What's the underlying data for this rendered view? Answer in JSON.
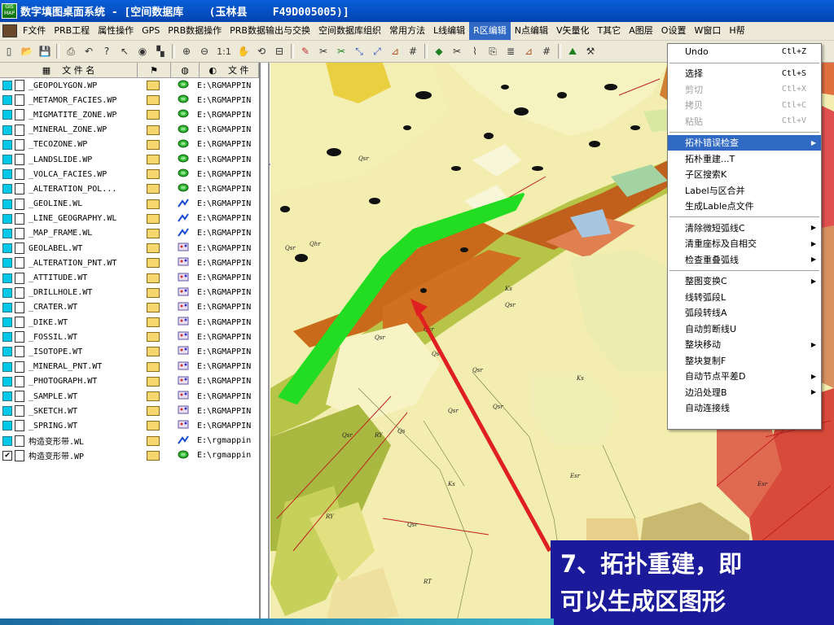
{
  "window": {
    "title": "数字填图桌面系统 - [空间数据库    (玉林县    F49D005005)]"
  },
  "menubar": {
    "items": [
      "F文件",
      "PRB工程",
      "属性操作",
      "GPS",
      "PRB数据操作",
      "PRB数据输出与交换",
      "空间数据库组织",
      "常用方法",
      "L线编辑",
      "R区编辑",
      "N点编辑",
      "V矢量化",
      "T其它",
      "A图层",
      "O设置",
      "W窗口",
      "H帮"
    ]
  },
  "file_panel": {
    "headers": [
      "文 件 名",
      "文 件"
    ],
    "rows": [
      {
        "checked": false,
        "name": "_GEOPOLYGON.WP",
        "type": "polygon",
        "path": "E:\\RGMAPPIN"
      },
      {
        "checked": false,
        "name": "_METAMOR_FACIES.WP",
        "type": "polygon",
        "path": "E:\\RGMAPPIN"
      },
      {
        "checked": false,
        "name": "_MIGMATITE_ZONE.WP",
        "type": "polygon",
        "path": "E:\\RGMAPPIN"
      },
      {
        "checked": false,
        "name": "_MINERAL_ZONE.WP",
        "type": "polygon",
        "path": "E:\\RGMAPPIN"
      },
      {
        "checked": false,
        "name": "_TECOZONE.WP",
        "type": "polygon",
        "path": "E:\\RGMAPPIN"
      },
      {
        "checked": false,
        "name": "_LANDSLIDE.WP",
        "type": "polygon",
        "path": "E:\\RGMAPPIN"
      },
      {
        "checked": false,
        "name": "_VOLCA_FACIES.WP",
        "type": "polygon",
        "path": "E:\\RGMAPPIN"
      },
      {
        "checked": false,
        "name": "_ALTERATION_POL...",
        "type": "polygon",
        "path": "E:\\RGMAPPIN"
      },
      {
        "checked": false,
        "name": "_GEOLINE.WL",
        "type": "line",
        "path": "E:\\RGMAPPIN"
      },
      {
        "checked": false,
        "name": "_LINE_GEOGRAPHY.WL",
        "type": "line",
        "path": "E:\\RGMAPPIN"
      },
      {
        "checked": false,
        "name": "_MAP_FRAME.WL",
        "type": "line",
        "path": "E:\\RGMAPPIN"
      },
      {
        "checked": false,
        "name": "GEOLABEL.WT",
        "type": "point",
        "path": "E:\\RGMAPPIN"
      },
      {
        "checked": false,
        "name": "_ALTERATION_PNT.WT",
        "type": "point",
        "path": "E:\\RGMAPPIN"
      },
      {
        "checked": false,
        "name": "_ATTITUDE.WT",
        "type": "point",
        "path": "E:\\RGMAPPIN"
      },
      {
        "checked": false,
        "name": "_DRILLHOLE.WT",
        "type": "point",
        "path": "E:\\RGMAPPIN"
      },
      {
        "checked": false,
        "name": "_CRATER.WT",
        "type": "point",
        "path": "E:\\RGMAPPIN"
      },
      {
        "checked": false,
        "name": "_DIKE.WT",
        "type": "point",
        "path": "E:\\RGMAPPIN"
      },
      {
        "checked": false,
        "name": "_FOSSIL.WT",
        "type": "point",
        "path": "E:\\RGMAPPIN"
      },
      {
        "checked": false,
        "name": "_ISOTOPE.WT",
        "type": "point",
        "path": "E:\\RGMAPPIN"
      },
      {
        "checked": false,
        "name": "_MINERAL_PNT.WT",
        "type": "point",
        "path": "E:\\RGMAPPIN"
      },
      {
        "checked": false,
        "name": "_PHOTOGRAPH.WT",
        "type": "point",
        "path": "E:\\RGMAPPIN"
      },
      {
        "checked": false,
        "name": "_SAMPLE.WT",
        "type": "point",
        "path": "E:\\RGMAPPIN"
      },
      {
        "checked": false,
        "name": "_SKETCH.WT",
        "type": "point",
        "path": "E:\\RGMAPPIN"
      },
      {
        "checked": false,
        "name": "_SPRING.WT",
        "type": "point",
        "path": "E:\\RGMAPPIN"
      },
      {
        "checked": false,
        "name": "构造变形带.WL",
        "type": "line",
        "path": "E:\\rgmappin"
      },
      {
        "checked": true,
        "name": "构造变形带.WP",
        "type": "polygon",
        "path": "E:\\rgmappin"
      }
    ]
  },
  "context_menu": {
    "items": [
      {
        "label": "Undo",
        "shortcut": "Ctl+Z",
        "disabled": false,
        "highlighted": false,
        "submenu": false
      },
      {
        "sep": true
      },
      {
        "label": "选择",
        "shortcut": "Ctl+S",
        "disabled": false,
        "highlighted": false,
        "submenu": false
      },
      {
        "label": "剪切",
        "shortcut": "Ctl+X",
        "disabled": true,
        "highlighted": false,
        "submenu": false
      },
      {
        "label": "拷贝",
        "shortcut": "Ctl+C",
        "disabled": true,
        "highlighted": false,
        "submenu": false
      },
      {
        "label": "粘贴",
        "shortcut": "Ctl+V",
        "disabled": true,
        "highlighted": false,
        "submenu": false
      },
      {
        "sep": true
      },
      {
        "label": "拓朴错误检查",
        "shortcut": "",
        "disabled": false,
        "highlighted": true,
        "submenu": true
      },
      {
        "label": "拓朴重建...T",
        "shortcut": "",
        "disabled": false,
        "highlighted": false,
        "submenu": false
      },
      {
        "label": "子区搜索K",
        "shortcut": "",
        "disabled": false,
        "highlighted": false,
        "submenu": false
      },
      {
        "label": "Label与区合并",
        "shortcut": "",
        "disabled": false,
        "highlighted": false,
        "submenu": false
      },
      {
        "label": "生成Lable点文件",
        "shortcut": "",
        "disabled": false,
        "highlighted": false,
        "submenu": false
      },
      {
        "sep": true
      },
      {
        "label": "清除微短弧线C",
        "shortcut": "",
        "disabled": false,
        "highlighted": false,
        "submenu": true
      },
      {
        "label": "清重座标及自相交",
        "shortcut": "",
        "disabled": false,
        "highlighted": false,
        "submenu": true
      },
      {
        "label": "检查重叠弧线",
        "shortcut": "",
        "disabled": false,
        "highlighted": false,
        "submenu": true
      },
      {
        "sep": true
      },
      {
        "label": "整图变换C",
        "shortcut": "",
        "disabled": false,
        "highlighted": false,
        "submenu": true
      },
      {
        "label": "线转弧段L",
        "shortcut": "",
        "disabled": false,
        "highlighted": false,
        "submenu": false
      },
      {
        "label": "弧段转线A",
        "shortcut": "",
        "disabled": false,
        "highlighted": false,
        "submenu": false
      },
      {
        "label": "自动剪断线U",
        "shortcut": "",
        "disabled": false,
        "highlighted": false,
        "submenu": false
      },
      {
        "label": "整块移动",
        "shortcut": "",
        "disabled": false,
        "highlighted": false,
        "submenu": true
      },
      {
        "label": "整块复制F",
        "shortcut": "",
        "disabled": false,
        "highlighted": false,
        "submenu": false
      },
      {
        "label": "自动节点平差D",
        "shortcut": "",
        "disabled": false,
        "highlighted": false,
        "submenu": true
      },
      {
        "label": "边沿处理B",
        "shortcut": "",
        "disabled": false,
        "highlighted": false,
        "submenu": true
      },
      {
        "label": "自动连接线",
        "shortcut": "",
        "disabled": false,
        "highlighted": false,
        "submenu": false
      }
    ]
  },
  "toolbar": {
    "zoom_label": "1:1"
  },
  "callout": {
    "line1": "7、拓扑重建，即",
    "line2": "可以生成区图形"
  },
  "colors": {
    "titlebar": "#0a5fd8",
    "menu_highlight": "#316ac5",
    "callout_bg": "#1a1a9a",
    "highlight_strip": "#22dd22",
    "arrow": "#e02020"
  }
}
